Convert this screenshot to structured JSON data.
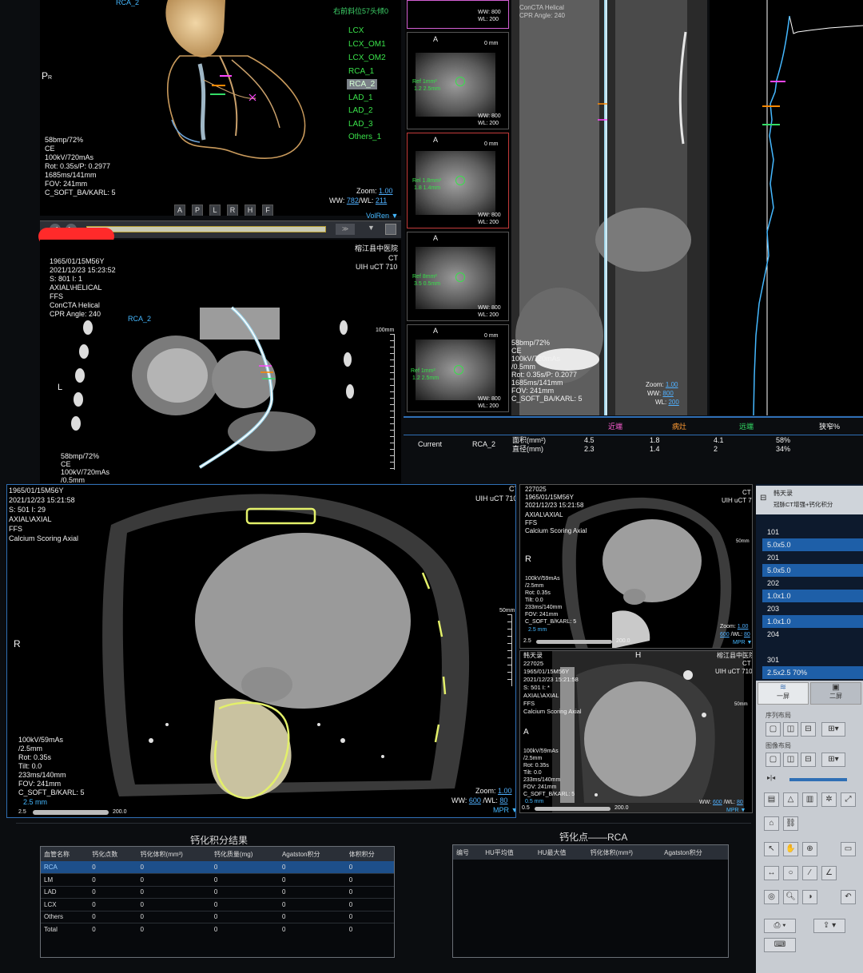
{
  "vr_view": {
    "label_rca": "RCA_2",
    "view_title": "右前斜位57头倾0",
    "orientation": "P",
    "orientation_sub": "R",
    "vessels": [
      "LCX",
      "LCX_OM1",
      "LCX_OM2",
      "RCA_1",
      "RCA_2",
      "LAD_1",
      "LAD_2",
      "LAD_3",
      "Others_1"
    ],
    "selected_vessel": "RCA_2",
    "info_lines": [
      "58bmp/72%",
      "CE",
      "100kV/720mAs",
      "Rot: 0.35s/P: 0.2977",
      "1685ms/141mm",
      "FOV: 241mm",
      "C_SOFT_BA/KARL: 5"
    ],
    "zoom_label": "Zoom:",
    "zoom_value": "1.00",
    "ww_label": "WW:",
    "ww_value": "782",
    "wl_label": "/WL:",
    "wl_value": "211",
    "dir_buttons": [
      "A",
      "P",
      "L",
      "R",
      "H",
      "F"
    ],
    "mode_label": "VolRen"
  },
  "cpr_view": {
    "hospital": "榕江县中医院",
    "modality": "CT",
    "device": "UIH uCT 710",
    "info_lines": [
      "1965/01/15M56Y",
      "2021/12/23 15:23:52",
      "S: 801 I: 1",
      "AXIAL\\HELICAL",
      "FFS",
      "ConCTA Helical",
      "CPR Angle: 240"
    ],
    "vessel_label": "RCA_2",
    "side_label": "L",
    "scale_label": "100mm",
    "bottom_lines": [
      "58bmp/72%",
      "CE",
      "100kV/720mAs",
      "/0.5mm"
    ]
  },
  "cross_sections": [
    {
      "ww": "800",
      "wl": "200"
    },
    {
      "label_a": "A",
      "dist": "0 mm",
      "ref": "Ref 1mm²",
      "ref2": "1.2 2.5mm",
      "ww": "800",
      "wl": "200"
    },
    {
      "label_a": "A",
      "dist": "0 mm",
      "ref": "Rel 1.8mm²",
      "ref2": "1.8 1.4mm",
      "ww": "800",
      "wl": "200"
    },
    {
      "label_a": "A",
      "dist": "",
      "ref": "Ref 8mm²",
      "ref2": "3.5 0.5mm",
      "ww": "800",
      "wl": "200"
    },
    {
      "label_a": "A",
      "dist": "0 mm",
      "ref": "Ref 1mm²",
      "ref2": "1.2 2.5mm",
      "ww": "800",
      "wl": "200"
    }
  ],
  "straight_view": {
    "top_lines": [
      "ConCTA Helical",
      "CPR Angle: 240"
    ],
    "info_lines": [
      "58bmp/72%",
      "CE",
      "100kV/720mAs",
      "/0.5mm",
      "Rot: 0.35s/P: 0.2077",
      "1685ms/141mm",
      "FOV: 241mm",
      "C_SOFT_BA/KARL: 5"
    ],
    "zoom_label": "Zoom:",
    "zoom_value": "1.00",
    "ww_label": "WW:",
    "ww_value": "800",
    "wl_label": "WL:",
    "wl_value": "200"
  },
  "stenosis": {
    "headers": [
      "近端",
      "病灶",
      "远端",
      "狭窄%"
    ],
    "row_label": "Current",
    "vessel": "RCA_2",
    "measures": [
      "面积(mm²)",
      "直径(mm)"
    ],
    "proximal": [
      "4.5",
      "2.3"
    ],
    "lesion": [
      "1.8",
      "1.4"
    ],
    "distal": [
      "4.1",
      "2"
    ],
    "percent": [
      "58%",
      "34%"
    ]
  },
  "axial_view": {
    "info_lines": [
      "1965/01/15M56Y",
      "2021/12/23 15:21:58",
      "S: 501 I: 29",
      "AXIAL\\AXIAL",
      "FFS",
      "Calcium Scoring Axial"
    ],
    "orientation": "R",
    "device": "UIH uCT 710",
    "modality": "CT",
    "scale_label": "50mm",
    "params": [
      "100kV/59mAs",
      "/2.5mm",
      "Rot: 0.35s",
      "Tilt: 0.0",
      "233ms/140mm",
      "FOV: 241mm",
      "C_SOFT_B/KARL: 5"
    ],
    "thickness": "2.5 mm",
    "slider_min": "2.5",
    "slider_max": "200.0",
    "zoom_label": "Zoom:",
    "zoom_value": "1.00",
    "ww_label": "WW:",
    "ww_value": "600",
    "wl_label": "/WL:",
    "wl_value": "80",
    "mode_label": "MPR"
  },
  "sagittal_view": {
    "info_lines": [
      "227025",
      "1965/01/15M56Y",
      "2021/12/23 15:21:58",
      "AXIAL\\AXIAL",
      "FFS",
      "Calcium Scoring Axial"
    ],
    "modality": "CT",
    "device": "UIH uCT 710",
    "orientation": "R",
    "params": [
      "100kV/59mAs",
      "/2.5mm",
      "Rot: 0.35s",
      "Tilt: 0.0",
      "233ms/140mm",
      "FOV: 241mm",
      "C_SOFT_B/KARL: 5"
    ],
    "thickness": "2.5 mm",
    "slider_min": "2.5",
    "slider_max": "200.0",
    "scale_label": "50mm",
    "zoom_label": "Zoom:",
    "zoom_value": "1.00",
    "ww_value": "600",
    "wl_value": "80",
    "mode_label": "MPR"
  },
  "coronal_view": {
    "name": "韩天录",
    "info_lines": [
      "227025",
      "1965/01/15M56Y",
      "2021/12/23 15:21:58",
      "S: 501 I: *",
      "AXIAL\\AXIAL",
      "FFS",
      "Calcium Scoring Axial"
    ],
    "orientation": "H",
    "side": "A",
    "hospital": "榕江县中医院",
    "modality": "CT",
    "device": "UIH uCT 710",
    "params": [
      "100kV/59mAs",
      "/2.5mm",
      "Rot: 0.35s",
      "Tilt: 0.0",
      "233ms/140mm",
      "FOV: 241mm",
      "C_SOFT_B/KARL: 5"
    ],
    "thickness": "0.5 mm",
    "slider_min": "0.5",
    "slider_max": "200.0",
    "scale_label": "50mm",
    "ww_value": "600",
    "wl_value": "80",
    "mode_label": "MPR"
  },
  "series_panel": {
    "patient": "韩天录",
    "study": "冠脉CT增强+钙化积分",
    "items": [
      "101",
      "5.0x5.0",
      "201",
      "5.0x5.0",
      "202",
      "1.0x1.0",
      "203",
      "1.0x1.0",
      "204",
      "301",
      "2.5x2.5 70%"
    ]
  },
  "tool_panel": {
    "tab1": "一屏",
    "tab2": "二屏",
    "section1": "序列布局",
    "section2": "图像布局"
  },
  "calcium_table": {
    "title": "钙化积分结果",
    "headers": [
      "血管名称",
      "钙化点数",
      "钙化体积(mm³)",
      "钙化质量(mg)",
      "Agatston积分",
      "体积积分"
    ],
    "rows": [
      [
        "RCA",
        "0",
        "0",
        "0",
        "0",
        "0"
      ],
      [
        "LM",
        "0",
        "0",
        "0",
        "0",
        "0"
      ],
      [
        "LAD",
        "0",
        "0",
        "0",
        "0",
        "0"
      ],
      [
        "LCX",
        "0",
        "0",
        "0",
        "0",
        "0"
      ],
      [
        "Others",
        "0",
        "0",
        "0",
        "0",
        "0"
      ],
      [
        "Total",
        "0",
        "0",
        "0",
        "0",
        "0"
      ]
    ]
  },
  "calcium_points": {
    "title": "钙化点——RCA",
    "headers": [
      "编号",
      "HU平均值",
      "HU最大值",
      "钙化体积(mm³)",
      "Agatston积分"
    ]
  }
}
